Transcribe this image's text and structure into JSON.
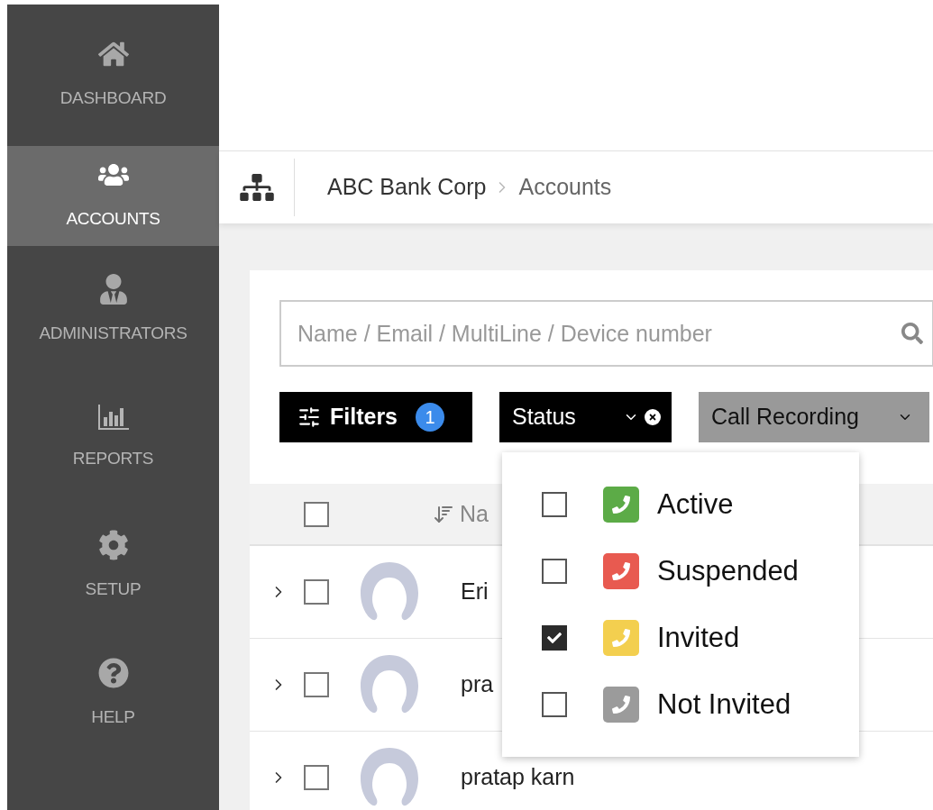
{
  "sidebar": {
    "items": [
      {
        "label": "DASHBOARD",
        "selected": false
      },
      {
        "label": "ACCOUNTS",
        "selected": true
      },
      {
        "label": "ADMINISTRATORS",
        "selected": false
      },
      {
        "label": "REPORTS",
        "selected": false
      },
      {
        "label": "SETUP",
        "selected": false
      },
      {
        "label": "HELP",
        "selected": false
      }
    ]
  },
  "breadcrumb": [
    "ABC Bank Corp",
    "Accounts"
  ],
  "search": {
    "placeholder": "Name / Email / MultiLine / Device number"
  },
  "filters": {
    "label": "Filters",
    "count": "1"
  },
  "chips": [
    {
      "label": "Status",
      "active": true,
      "clearable": true
    },
    {
      "label": "Call Recording",
      "active": false,
      "clearable": false
    }
  ],
  "table": {
    "header": {
      "checked": false,
      "column": "Na"
    },
    "rows": [
      {
        "name": "Eri",
        "checked": false,
        "expanded": false
      },
      {
        "name": "pra",
        "checked": false,
        "expanded": false
      },
      {
        "name": "pratap karn",
        "checked": false,
        "expanded": false
      }
    ]
  },
  "status_menu": {
    "options": [
      {
        "label": "Active",
        "color": "#5cab47",
        "checked": false
      },
      {
        "label": "Suspended",
        "color": "#e85a50",
        "checked": false
      },
      {
        "label": "Invited",
        "color": "#f3cf4f",
        "checked": true
      },
      {
        "label": "Not Invited",
        "color": "#9b9b9b",
        "checked": false
      }
    ]
  }
}
